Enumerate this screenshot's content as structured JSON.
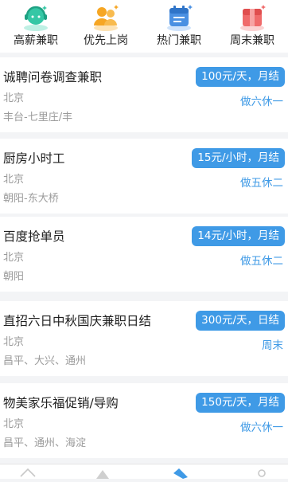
{
  "categories": [
    {
      "label": "高薪兼职",
      "icon": "headset-icon",
      "color": "#35c7a5"
    },
    {
      "label": "优先上岗",
      "icon": "users-icon",
      "color": "#f6a623"
    },
    {
      "label": "热门兼职",
      "icon": "calendar-icon",
      "color": "#4a90e2"
    },
    {
      "label": "周末兼职",
      "icon": "box-icon",
      "color": "#f06b6b"
    }
  ],
  "jobs": [
    {
      "title": "诚聘问卷调查兼职",
      "city": "北京",
      "area": "丰台-七里庄/丰",
      "pay": "100元/天，月结",
      "rest": "做六休一"
    },
    {
      "title": "厨房小时工",
      "city": "北京",
      "area": "朝阳-东大桥",
      "pay": "15元/小时，月结",
      "rest": "做五休二"
    },
    {
      "title": "百度抢单员",
      "city": "北京",
      "area": "朝阳",
      "pay": "14元/小时，月结",
      "rest": "做五休二"
    },
    {
      "title": "直招六日中秋国庆兼职日结",
      "city": "北京",
      "area": "昌平、大兴、通州",
      "pay": "300元/天，日结",
      "rest": "周末"
    },
    {
      "title": "物美家乐福促销/导购",
      "city": "北京",
      "area": "昌平、通州、海淀",
      "pay": "150元/天，月结",
      "rest": "做六休一"
    }
  ],
  "accent": "#3f9ae6"
}
